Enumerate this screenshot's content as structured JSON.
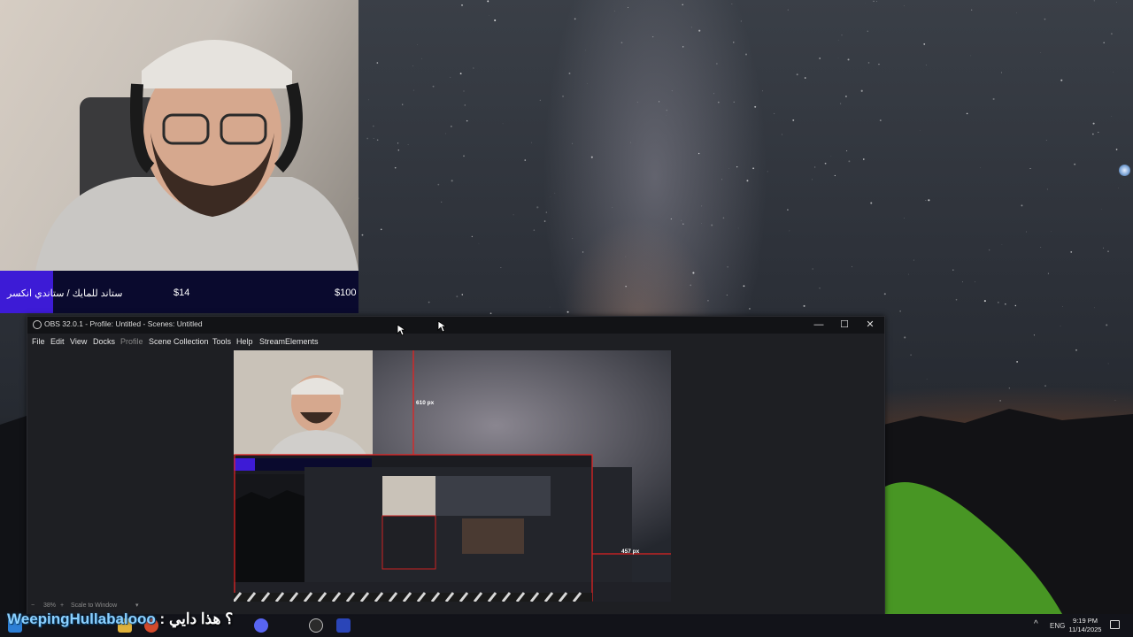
{
  "goal_bar": {
    "label": "ستاند للمايك / ستاندي انكسر",
    "current": "$14",
    "target": "$100",
    "colors": {
      "accent": "#3d1bd6",
      "background": "#0a0a2e"
    }
  },
  "obs": {
    "title": "OBS 32.0.1 - Profile: Untitled - Scenes: Untitled",
    "window_controls": {
      "minimize": "—",
      "maximize": "☐",
      "close": "✕"
    },
    "menu": [
      "File",
      "Edit",
      "View",
      "Docks",
      "Profile",
      "Scene Collection",
      "Tools",
      "Help",
      "StreamElements"
    ],
    "preview_labels": {
      "height": "610 px",
      "width": "457 px"
    },
    "status": {
      "zoom": "38%",
      "scale_mode": "Scale to Window"
    }
  },
  "chat": {
    "username": "WeepingHullabalooo",
    "separator": ":",
    "message": "؟ هذا دايي"
  },
  "taskbar": {
    "icons": [
      "start-icon",
      "explorer-icon",
      "chrome-icon",
      "discord-icon",
      "obs-icon",
      "media-player-icon"
    ],
    "tray": {
      "chevron": "^",
      "language": "ENG",
      "time": "9:19 PM",
      "date": "11/14/2025"
    }
  }
}
